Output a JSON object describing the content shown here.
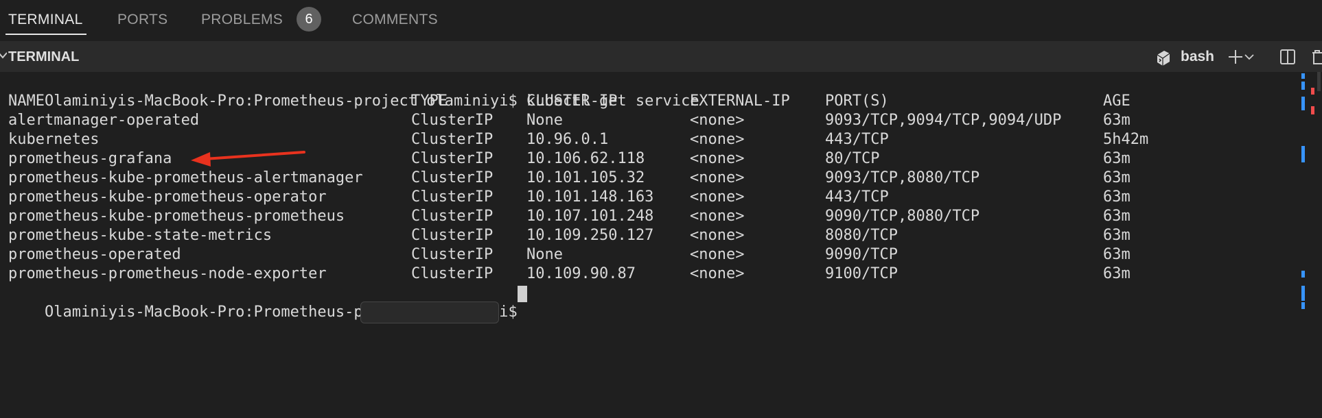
{
  "panel_tabs": {
    "terminal": "TERMINAL",
    "ports": "PORTS",
    "problems": "PROBLEMS",
    "problems_count": "6",
    "comments": "COMMENTS"
  },
  "terminal_header": {
    "title": "TERMINAL",
    "shell": "bash"
  },
  "terminal": {
    "prompt": "Olaminiyis-MacBook-Pro:Prometheus-project olaminiyi$",
    "command": "kubectl get service",
    "headers": [
      "NAME",
      "TYPE",
      "CLUSTER-IP",
      "EXTERNAL-IP",
      "PORT(S)",
      "AGE"
    ],
    "rows": [
      [
        "alertmanager-operated",
        "ClusterIP",
        "None",
        "<none>",
        "9093/TCP,9094/TCP,9094/UDP",
        "63m"
      ],
      [
        "kubernetes",
        "ClusterIP",
        "10.96.0.1",
        "<none>",
        "443/TCP",
        "5h42m"
      ],
      [
        "prometheus-grafana",
        "ClusterIP",
        "10.106.62.118",
        "<none>",
        "80/TCP",
        "63m"
      ],
      [
        "prometheus-kube-prometheus-alertmanager",
        "ClusterIP",
        "10.101.105.32",
        "<none>",
        "9093/TCP,8080/TCP",
        "63m"
      ],
      [
        "prometheus-kube-prometheus-operator",
        "ClusterIP",
        "10.101.148.163",
        "<none>",
        "443/TCP",
        "63m"
      ],
      [
        "prometheus-kube-prometheus-prometheus",
        "ClusterIP",
        "10.107.101.248",
        "<none>",
        "9090/TCP,8080/TCP",
        "63m"
      ],
      [
        "prometheus-kube-state-metrics",
        "ClusterIP",
        "10.109.250.127",
        "<none>",
        "8080/TCP",
        "63m"
      ],
      [
        "prometheus-operated",
        "ClusterIP",
        "None",
        "<none>",
        "9090/TCP",
        "63m"
      ],
      [
        "prometheus-prometheus-node-exporter",
        "ClusterIP",
        "10.109.90.87",
        "<none>",
        "9100/TCP",
        "63m"
      ]
    ],
    "final_prompt": "Olaminiyis-MacBook-Pro:Prometheus-project olaminiyi$"
  },
  "annotation": {
    "arrow_color": "#e8321e",
    "target_row": "prometheus-grafana"
  },
  "colors": {
    "background": "#1f1f1f",
    "header_background": "#2b2b2b",
    "scroll_mark_blue": "#3794ff",
    "scroll_mark_red": "#f14c4c"
  },
  "icons": {
    "collapse": "chevron-down-icon",
    "shell": "terminal-shell-icon",
    "new_terminal": "plus-icon",
    "launch_profile": "chevron-down-icon",
    "split": "split-editor-icon",
    "kill": "trash-icon"
  }
}
